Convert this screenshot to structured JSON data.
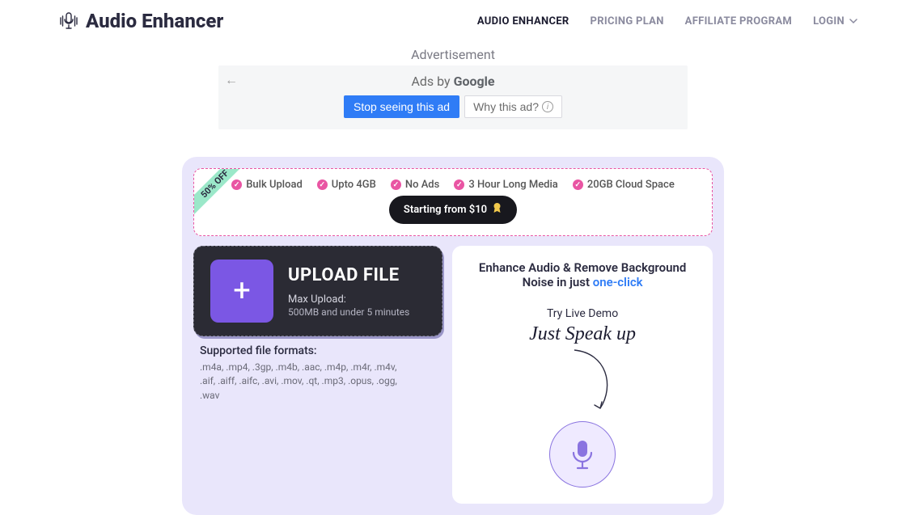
{
  "brand": {
    "name": "Audio Enhancer"
  },
  "nav": {
    "items": [
      {
        "label": "AUDIO ENHANCER",
        "active": true
      },
      {
        "label": "PRICING PLAN",
        "active": false
      },
      {
        "label": "AFFILIATE PROGRAM",
        "active": false
      }
    ],
    "login": "LOGIN"
  },
  "ad": {
    "label": "Advertisement",
    "title_prefix": "Ads by ",
    "title_brand": "Google",
    "stop": "Stop seeing this ad",
    "why": "Why this ad?"
  },
  "promo": {
    "ribbon": "50% OFF",
    "features": [
      "Bulk Upload",
      "Upto 4GB",
      "No Ads",
      "3 Hour Long Media",
      "20GB Cloud Space"
    ],
    "price": "Starting from $10"
  },
  "upload": {
    "title": "UPLOAD FILE",
    "line1": "Max Upload:",
    "line2": "500MB and under 5 minutes"
  },
  "formats": {
    "title": "Supported file formats:",
    "list": ".m4a, .mp4, .3gp, .m4b, .aac, .m4p, .m4r, .m4v, .aif, .aiff, .aifc, .avi, .mov, .qt, .mp3, .opus, .ogg, .wav"
  },
  "hero": {
    "title_pre": "Enhance Audio & Remove Background Noise in just ",
    "title_link": "one-click",
    "demo": "Try Live Demo",
    "speak": "Just Speak up"
  }
}
